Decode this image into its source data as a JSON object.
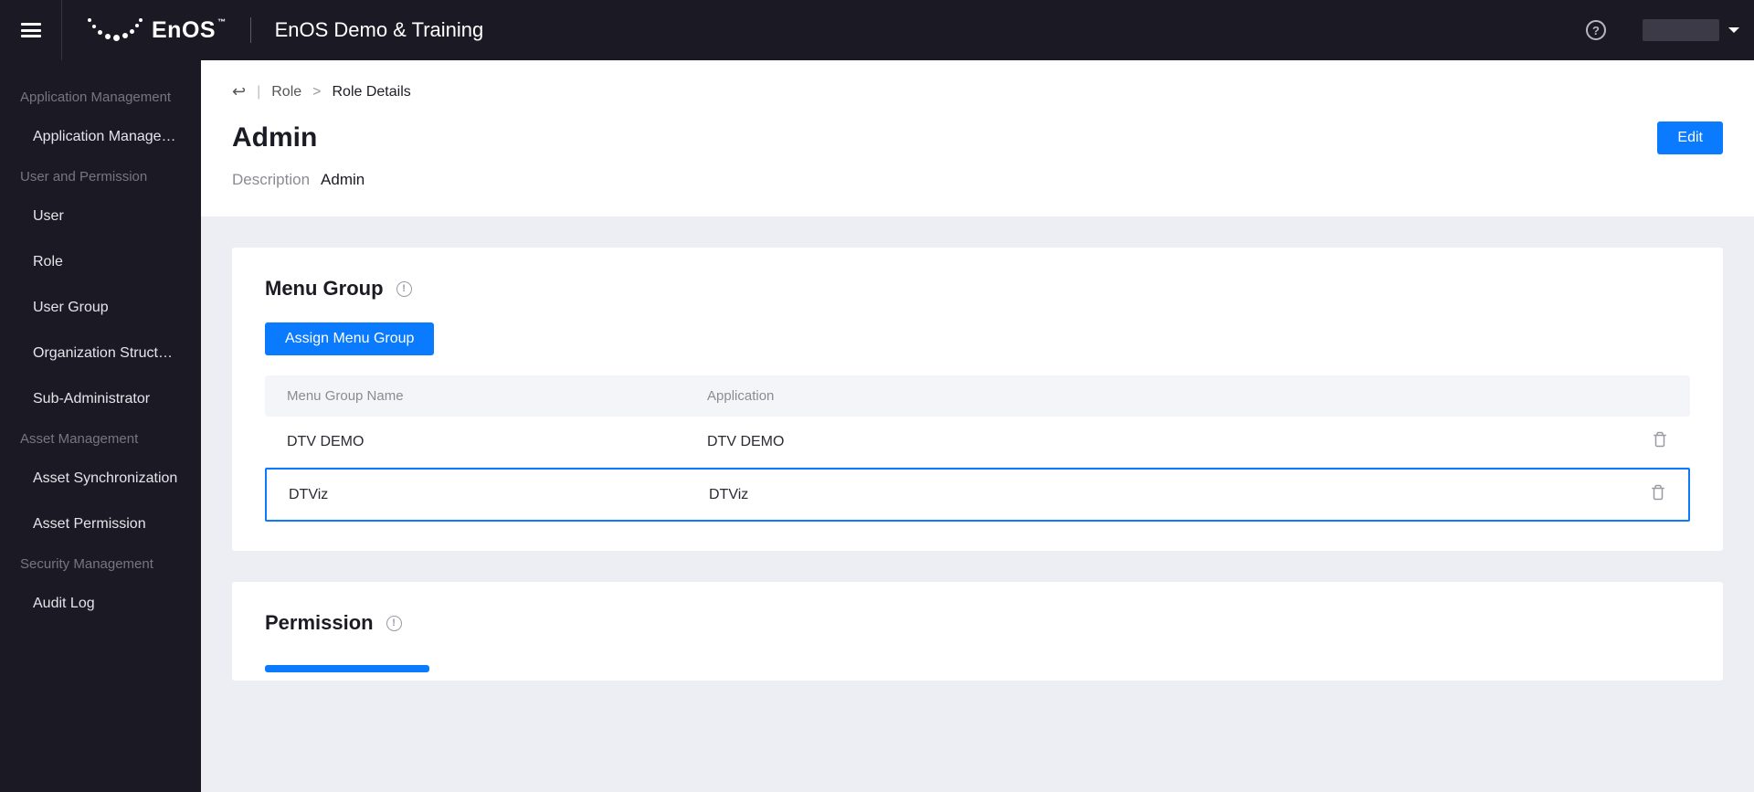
{
  "header": {
    "logo_text": "EnOS",
    "app_title": "EnOS Demo & Training"
  },
  "sidebar": {
    "groups": [
      {
        "label": "Application Management",
        "items": [
          "Application Manage…"
        ]
      },
      {
        "label": "User and Permission",
        "items": [
          "User",
          "Role",
          "User Group",
          "Organization Struct…",
          "Sub-Administrator"
        ]
      },
      {
        "label": "Asset Management",
        "items": [
          "Asset Synchronization",
          "Asset Permission"
        ]
      },
      {
        "label": "Security Management",
        "items": [
          "Audit Log"
        ]
      }
    ]
  },
  "breadcrumb": {
    "link": "Role",
    "separator": ">",
    "current": "Role Details"
  },
  "page": {
    "title": "Admin",
    "edit_label": "Edit",
    "desc_label": "Description",
    "desc_value": "Admin"
  },
  "menu_group_card": {
    "title": "Menu Group",
    "assign_label": "Assign Menu Group",
    "columns": {
      "name": "Menu Group Name",
      "app": "Application"
    },
    "rows": [
      {
        "name": "DTV DEMO",
        "app": "DTV DEMO",
        "highlight": false
      },
      {
        "name": "DTViz",
        "app": "DTViz",
        "highlight": true
      }
    ]
  },
  "permission_card": {
    "title": "Permission"
  }
}
